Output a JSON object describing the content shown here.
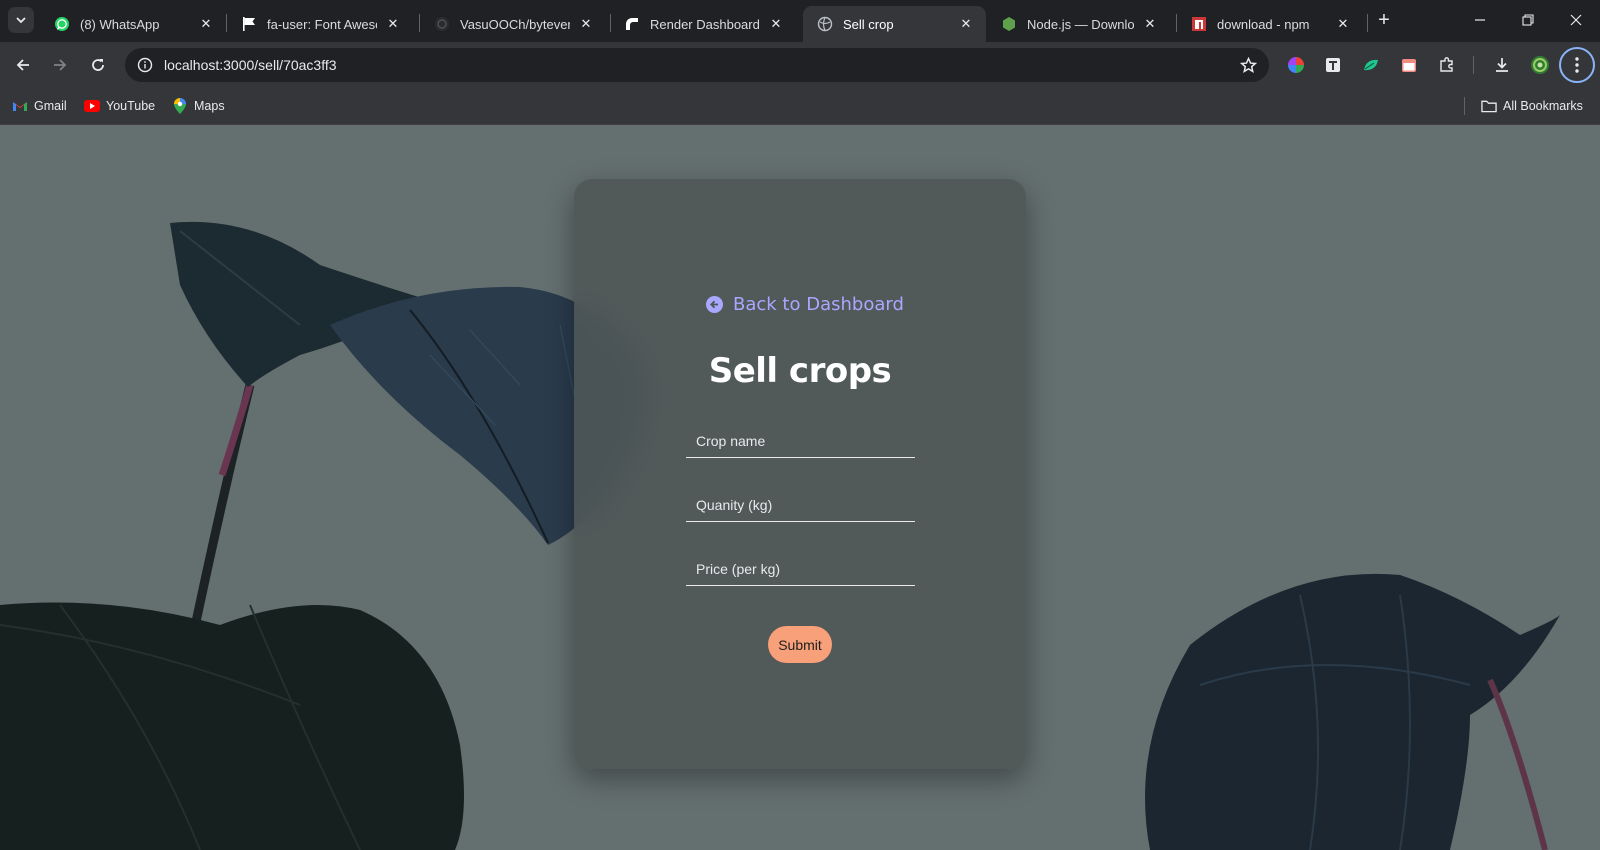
{
  "browser": {
    "tabs": [
      {
        "title": "(8) WhatsApp",
        "icon": "whatsapp-icon"
      },
      {
        "title": "fa-user: Font Awesome",
        "icon": "flag-icon"
      },
      {
        "title": "VasuOOCh/byteverse",
        "icon": "github-icon"
      },
      {
        "title": "Render Dashboard",
        "icon": "render-icon"
      },
      {
        "title": "Sell crop",
        "icon": "globe-icon",
        "active": true
      },
      {
        "title": "Node.js — Download",
        "icon": "nodejs-icon"
      },
      {
        "title": "download - npm",
        "icon": "npm-icon"
      }
    ],
    "new_tab": "+",
    "address": "localhost:3000/sell/70ac3ff3",
    "bookmarks": [
      {
        "label": "Gmail",
        "icon": "gmail-icon"
      },
      {
        "label": "YouTube",
        "icon": "youtube-icon"
      },
      {
        "label": "Maps",
        "icon": "maps-icon"
      }
    ],
    "all_bookmarks": "All Bookmarks"
  },
  "page": {
    "back_link": "Back to Dashboard",
    "heading": "Sell crops",
    "fields": {
      "crop_name": {
        "placeholder": "Crop name",
        "value": ""
      },
      "quantity": {
        "placeholder": "Quanity (kg)",
        "value": ""
      },
      "price": {
        "placeholder": "Price (per kg)",
        "value": ""
      }
    },
    "submit": "Submit"
  },
  "colors": {
    "page_background": "#646f6f",
    "card_background": "#4e5657",
    "link_accent": "#a9a8ff",
    "submit_button": "#f7a07a",
    "chrome_dark": "#202124",
    "chrome_toolbar": "#35363a"
  }
}
